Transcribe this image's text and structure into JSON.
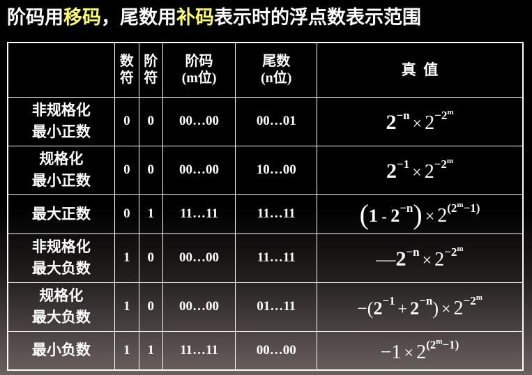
{
  "title": {
    "p1": "阶码用",
    "p2": "移码",
    "p3": "，尾数用",
    "p4": "补码",
    "p5": "表示时的浮点数表示范围"
  },
  "headers": {
    "sign": [
      "数",
      "符"
    ],
    "exp_sign": [
      "阶",
      "符"
    ],
    "exp": [
      "阶码",
      "(m位)"
    ],
    "mantissa": [
      "尾数",
      "(n位)"
    ],
    "value": "真  值"
  },
  "rows": [
    {
      "label": [
        "非规格化",
        "最小正数"
      ],
      "sign": "0",
      "exp_sign": "0",
      "exp": "00…00",
      "mantissa": "00…01"
    },
    {
      "label": [
        "规格化",
        "最小正数"
      ],
      "sign": "0",
      "exp_sign": "0",
      "exp": "00…00",
      "mantissa": "10…00"
    },
    {
      "label": [
        "最大正数"
      ],
      "sign": "0",
      "exp_sign": "1",
      "exp": "11…11",
      "mantissa": "11…11"
    },
    {
      "label": [
        "非规格化",
        "最大负数"
      ],
      "sign": "1",
      "exp_sign": "0",
      "exp": "00…00",
      "mantissa": "11…11"
    },
    {
      "label": [
        "规格化",
        "最大负数"
      ],
      "sign": "1",
      "exp_sign": "0",
      "exp": "00…00",
      "mantissa": "01…11"
    },
    {
      "label": [
        "最小负数"
      ],
      "sign": "1",
      "exp_sign": "1",
      "exp": "11…11",
      "mantissa": "00…00"
    }
  ],
  "formula_tokens": {
    "two": "2",
    "neg_n": "−n",
    "neg_one": "−1",
    "neg_two": "−2",
    "m": "m",
    "times": "×",
    "one": "1",
    "minus_sign": "—",
    "paren_open": "(",
    "paren_close": ")",
    "dash_minus": " - ",
    "plus": "+",
    "neg_paren_open": "−(",
    "neg_one_int": "−1",
    "exp_open": "(2",
    "exp_tail": "−1)"
  },
  "colors": {
    "highlight": "#ffff66",
    "text": "#ffffff",
    "border": "#ffffff"
  }
}
